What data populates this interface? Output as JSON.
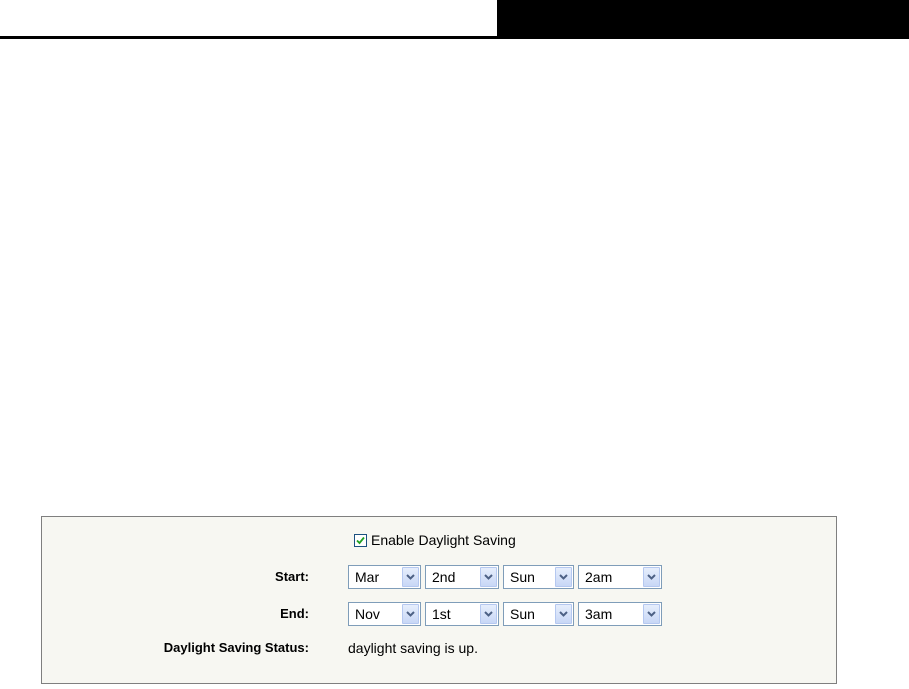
{
  "enable_daylight_saving": {
    "label": "Enable Daylight Saving",
    "checked": true
  },
  "start": {
    "label": "Start:",
    "month": "Mar",
    "week": "2nd",
    "day": "Sun",
    "hour": "2am"
  },
  "end": {
    "label": "End:",
    "month": "Nov",
    "week": "1st",
    "day": "Sun",
    "hour": "3am"
  },
  "status": {
    "label": "Daylight Saving Status:",
    "value": "daylight saving is up."
  },
  "colors": {
    "panel_background": "#f7f7f2",
    "panel_border": "#7f7f7f",
    "select_border": "#7f9db9",
    "checkmark": "#21a121"
  },
  "icons": {
    "checkbox": "check-icon",
    "dropdown": "chevron-down-icon"
  }
}
